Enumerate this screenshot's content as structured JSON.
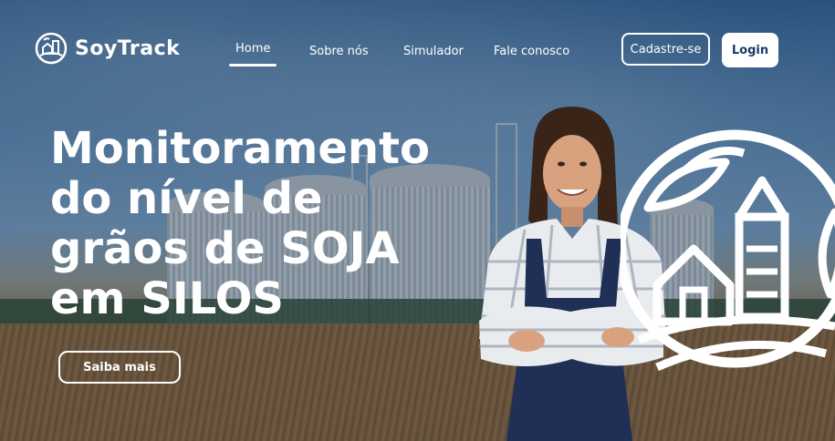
{
  "brand": {
    "name": "SoyTrack",
    "icon": "globe-farm-icon"
  },
  "nav": {
    "items": [
      {
        "label": "Home",
        "active": true
      },
      {
        "label": "Sobre  nós",
        "active": false
      },
      {
        "label": "Simulador",
        "active": false
      },
      {
        "label": "Fale conosco",
        "active": false
      }
    ]
  },
  "auth": {
    "signup_label": "Cadastre-se",
    "login_label": "Login"
  },
  "hero": {
    "headline_lines": [
      "Monitoramento",
      "do nível de",
      "grãos de SOJA",
      "em SILOS"
    ],
    "cta_label": "Saiba mais"
  },
  "colors": {
    "text": "#ffffff",
    "login_text": "#1b3a66",
    "sky": "#4b78a3",
    "field": "#7a5a36"
  }
}
